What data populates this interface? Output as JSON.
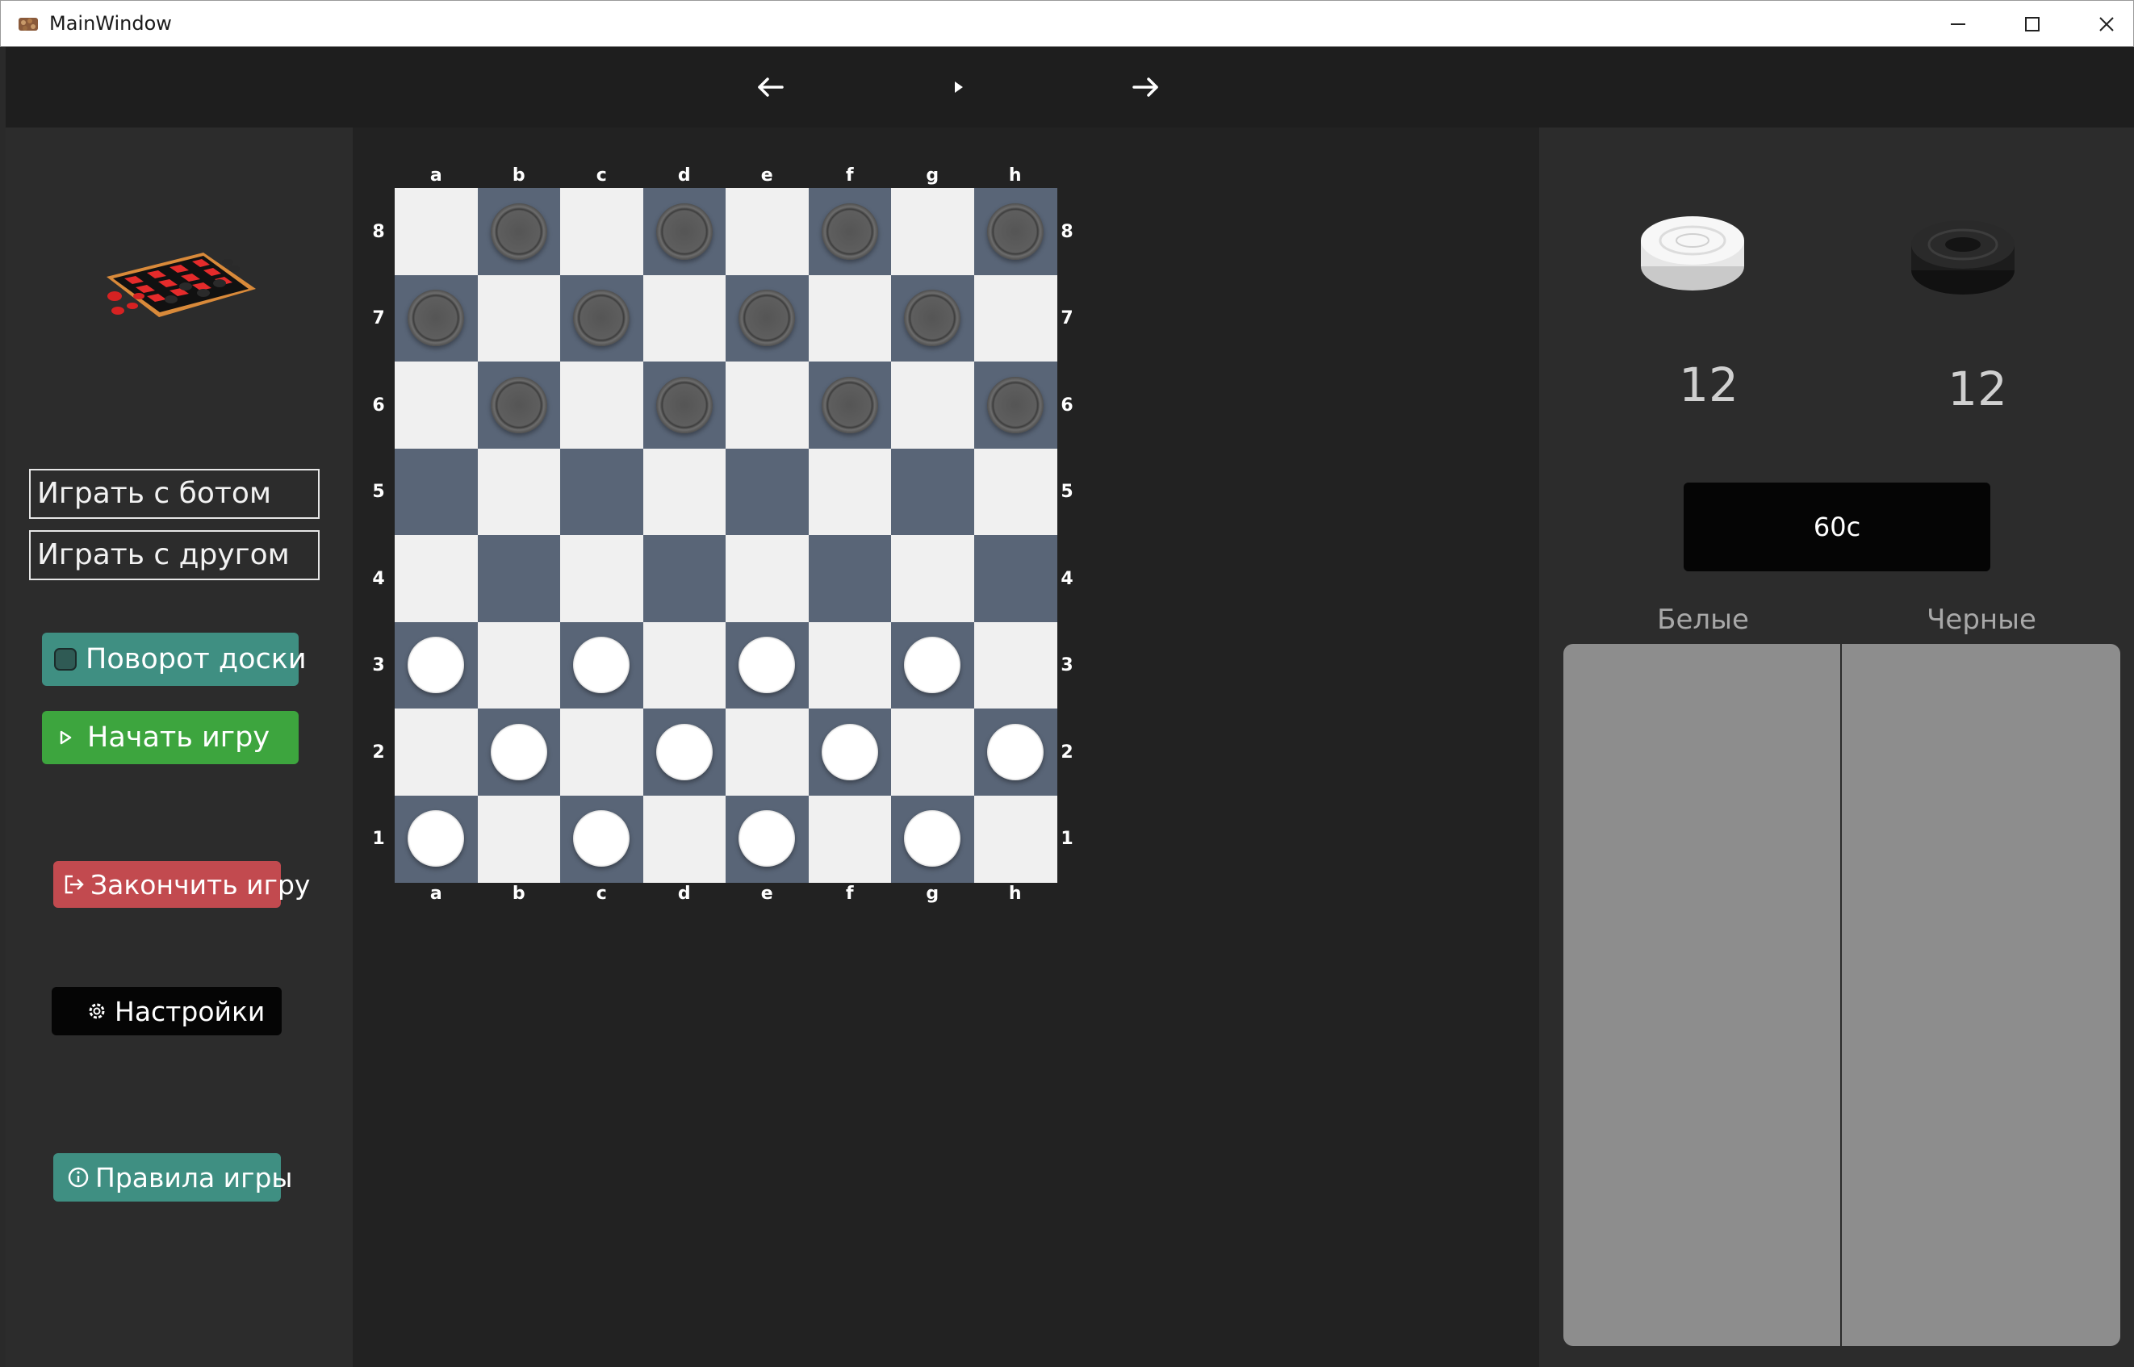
{
  "window": {
    "title": "MainWindow",
    "controls": [
      "minimize",
      "maximize",
      "close"
    ]
  },
  "toolbar": {
    "back_icon": "arrow-left-icon",
    "play_icon": "play-icon",
    "forward_icon": "arrow-right-icon"
  },
  "sidebar": {
    "play_bot_label": "Играть с ботом",
    "play_friend_label": "Играть с другом",
    "rotate_board_label": "Поворот доски",
    "start_game_label": "Начать игру",
    "end_game_label": "Закончить игру",
    "settings_label": "Настройки",
    "rules_label": "Правила игры",
    "colors": {
      "rotate": "#3f8f82",
      "start": "#3da53e",
      "end": "#c24a4f",
      "settings": "#050505",
      "rules": "#3f8f82"
    }
  },
  "board": {
    "files": [
      "a",
      "b",
      "c",
      "d",
      "e",
      "f",
      "g",
      "h"
    ],
    "ranks": [
      "8",
      "7",
      "6",
      "5",
      "4",
      "3",
      "2",
      "1"
    ],
    "light_color": "#f0f0f0",
    "dark_color": "#596577",
    "pieces": {
      "black": [
        "b8",
        "d8",
        "f8",
        "h8",
        "a7",
        "c7",
        "e7",
        "g7",
        "b6",
        "d6",
        "f6",
        "h6"
      ],
      "white": [
        "a3",
        "c3",
        "e3",
        "g3",
        "b2",
        "d2",
        "f2",
        "h2",
        "a1",
        "c1",
        "e1",
        "g1"
      ]
    }
  },
  "score": {
    "white_count": "12",
    "black_count": "12"
  },
  "timer": {
    "value": "60с"
  },
  "moves": {
    "white_header": "Белые",
    "black_header": "Черные",
    "white_moves": [],
    "black_moves": []
  }
}
